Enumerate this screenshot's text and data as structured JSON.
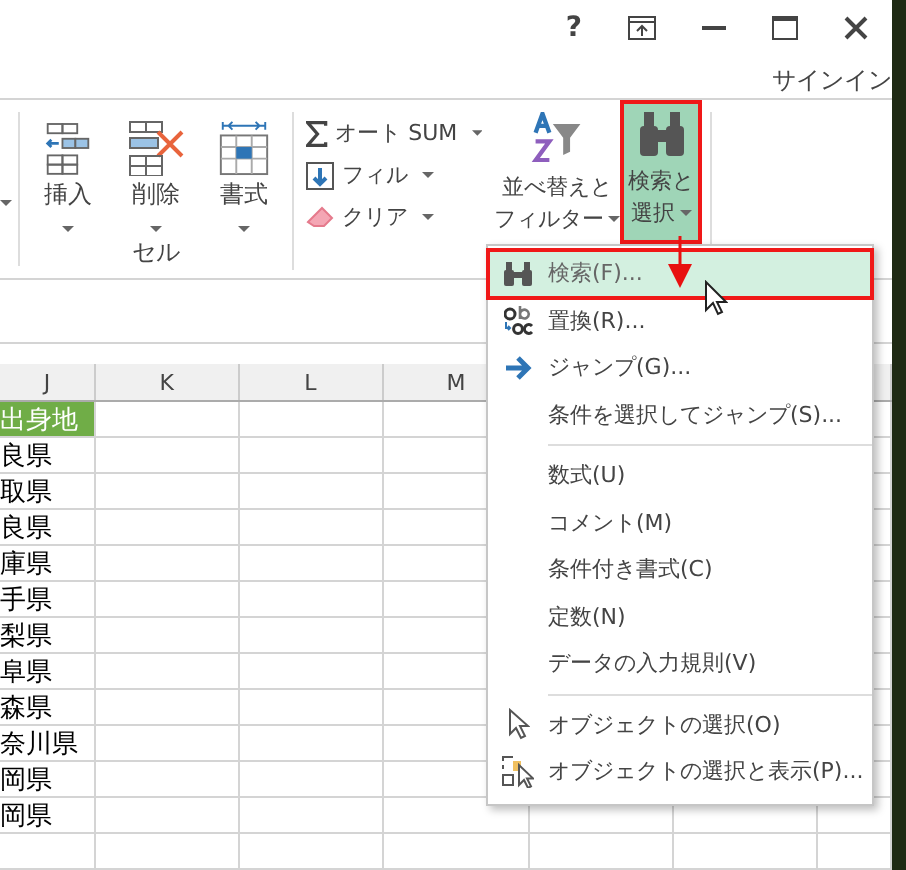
{
  "window_controls": [
    {
      "kind": "help",
      "text": "?"
    },
    {
      "kind": "ribbon_display"
    },
    {
      "kind": "minimize"
    },
    {
      "kind": "maximize"
    },
    {
      "kind": "close"
    }
  ],
  "sign_in": "サインイン",
  "ribbon": {
    "cells_group": {
      "label": "セル",
      "buttons": [
        {
          "label": "挿入"
        },
        {
          "label": "削除"
        },
        {
          "label": "書式"
        }
      ]
    },
    "editing_group": {
      "small_buttons": [
        {
          "label": "オート SUM"
        },
        {
          "label": "フィル"
        },
        {
          "label": "クリア"
        }
      ],
      "big_buttons": [
        {
          "lines": [
            "並べ替えと",
            "フィルター"
          ],
          "selected": false
        },
        {
          "lines": [
            "検索と",
            "選択"
          ],
          "selected": true
        }
      ]
    }
  },
  "sheet": {
    "columns": [
      "J",
      "K",
      "L",
      "M"
    ],
    "rows": [
      {
        "kind": "header",
        "text": "出身地"
      },
      {
        "kind": "data",
        "text": "良県"
      },
      {
        "kind": "data",
        "text": "取県"
      },
      {
        "kind": "data",
        "text": "良県"
      },
      {
        "kind": "data",
        "text": "庫県"
      },
      {
        "kind": "data",
        "text": "手県"
      },
      {
        "kind": "data",
        "text": "梨県"
      },
      {
        "kind": "data",
        "text": "阜県"
      },
      {
        "kind": "data",
        "text": "森県"
      },
      {
        "kind": "data",
        "text": "奈川県"
      },
      {
        "kind": "data",
        "text": "岡県"
      },
      {
        "kind": "data",
        "text": "岡県"
      }
    ]
  },
  "menu": [
    {
      "kind": "item",
      "label": "検索(F)...",
      "selected": true
    },
    {
      "kind": "item",
      "label": "置換(R)...",
      "selected": false
    },
    {
      "kind": "item",
      "label": "ジャンプ(G)...",
      "selected": false
    },
    {
      "kind": "item",
      "label": "条件を選択してジャンプ(S)...",
      "selected": false
    },
    {
      "kind": "separator"
    },
    {
      "kind": "item",
      "label": "数式(U)",
      "selected": false
    },
    {
      "kind": "item",
      "label": "コメント(M)",
      "selected": false
    },
    {
      "kind": "item",
      "label": "条件付き書式(C)",
      "selected": false
    },
    {
      "kind": "item",
      "label": "定数(N)",
      "selected": false
    },
    {
      "kind": "item",
      "label": "データの入力規則(V)",
      "selected": false
    },
    {
      "kind": "separator"
    },
    {
      "kind": "item",
      "label": "オブジェクトの選択(O)",
      "selected": false
    },
    {
      "kind": "item",
      "label": "オブジェクトの選択と表示(P)...",
      "selected": false
    }
  ]
}
